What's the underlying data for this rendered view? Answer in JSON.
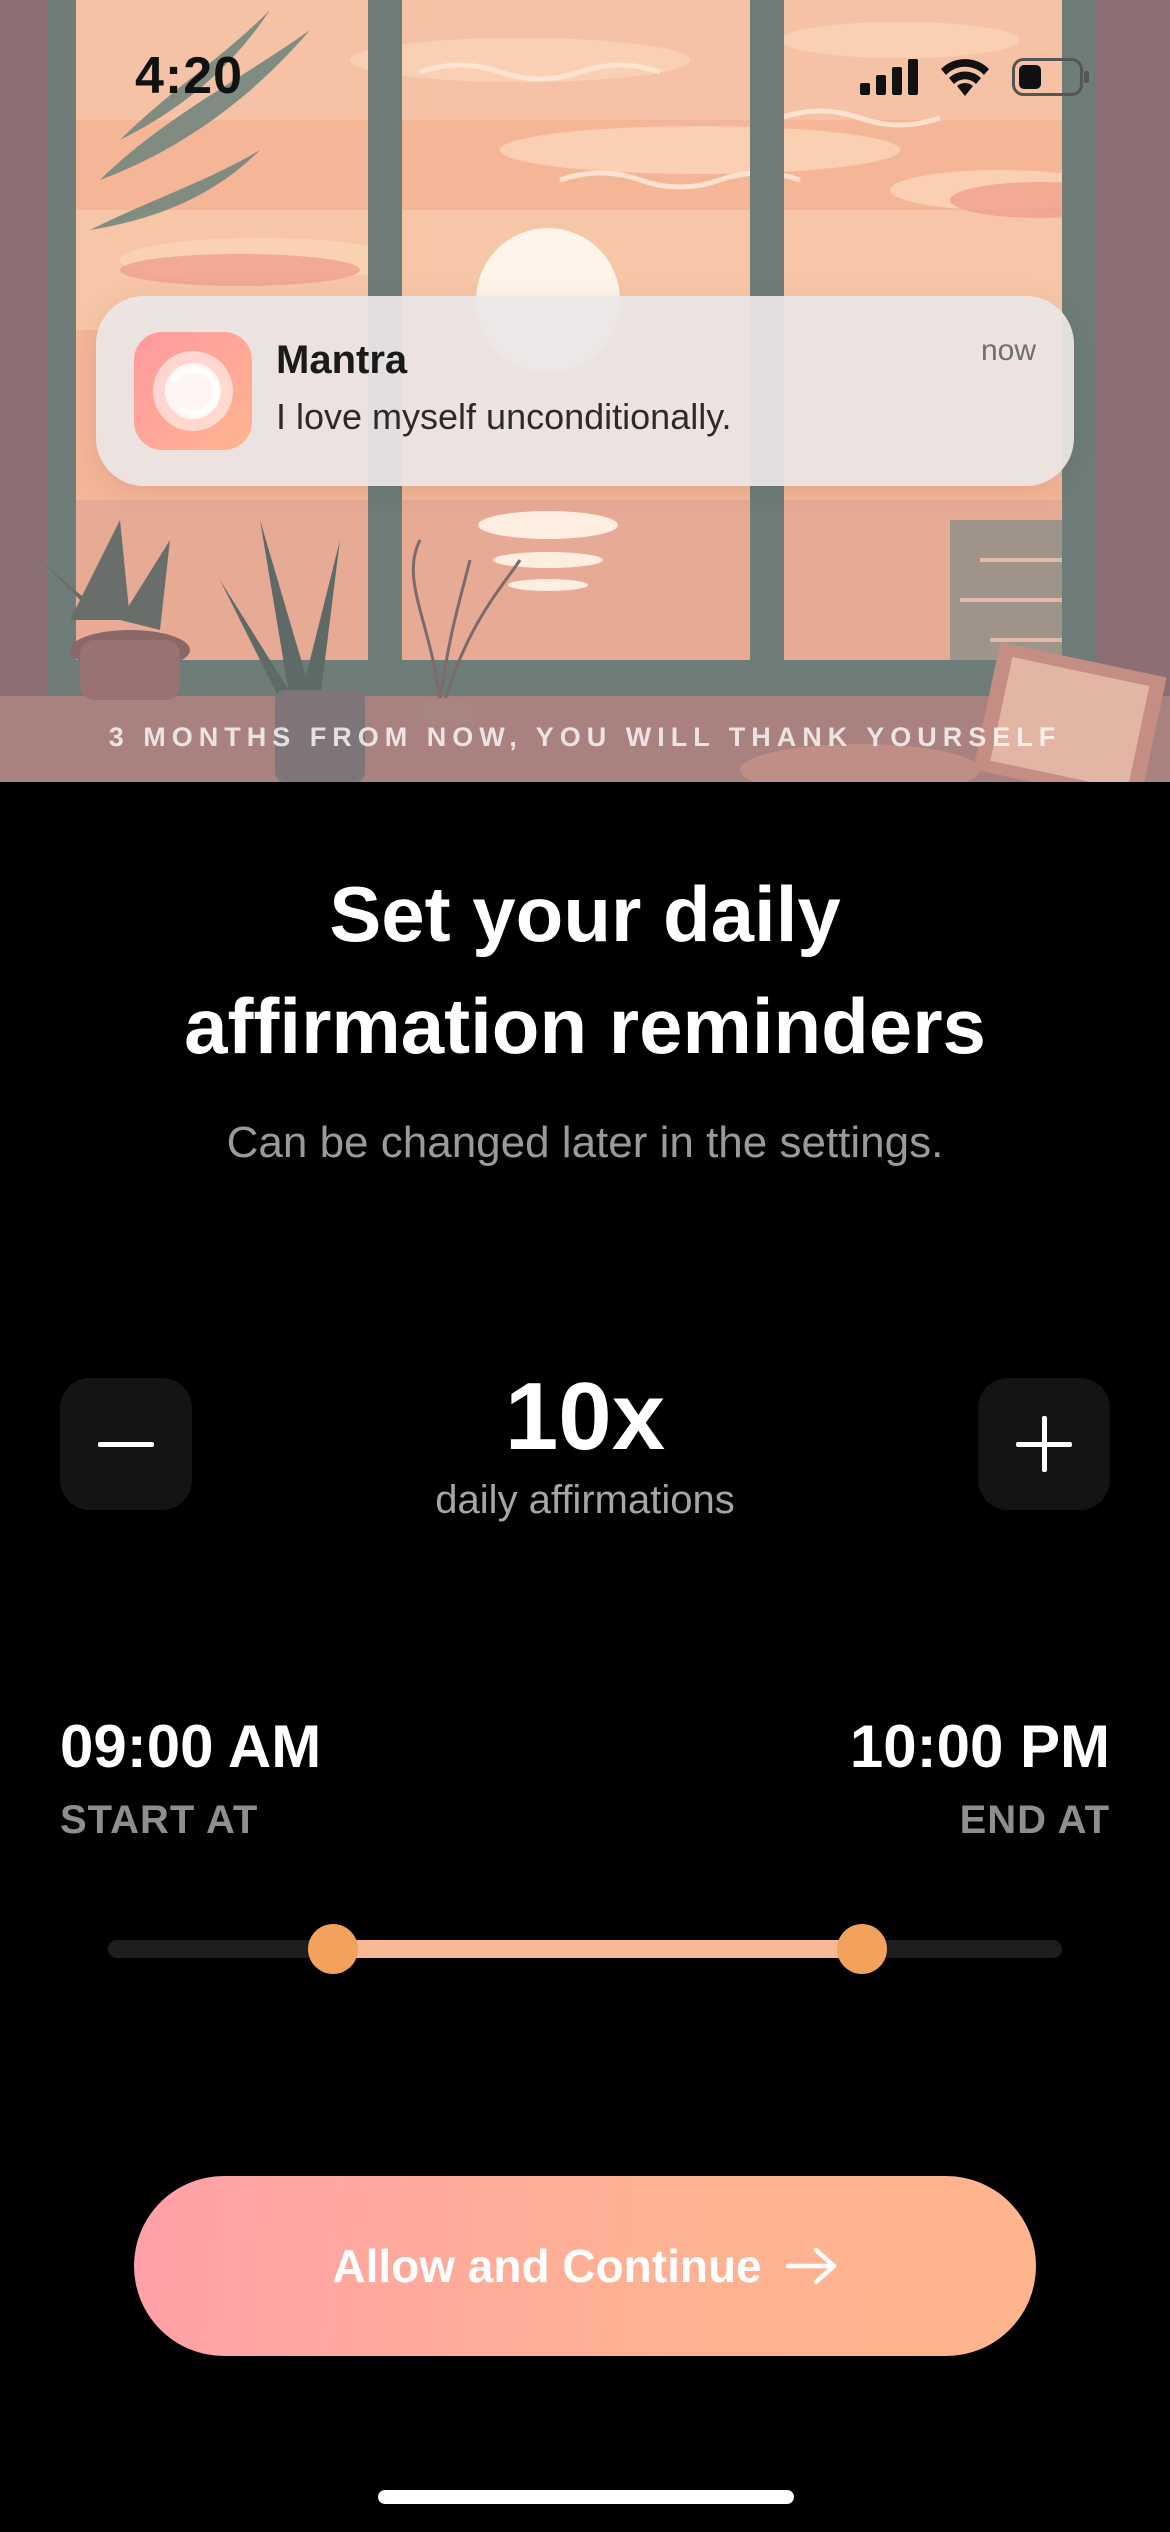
{
  "status_bar": {
    "time": "4:20",
    "icons": [
      "cellular-signal-icon",
      "wifi-icon",
      "battery-icon"
    ]
  },
  "notification": {
    "app_name": "Mantra",
    "message": "I love myself unconditionally.",
    "time": "now",
    "icon": "mantra-app-icon"
  },
  "hero": {
    "tagline": "3 MONTHS FROM NOW, YOU WILL THANK YOURSELF"
  },
  "content": {
    "title_line1": "Set your daily",
    "title_line2": "affirmation reminders",
    "subtitle": "Can be changed later in the settings."
  },
  "stepper": {
    "value": "10x",
    "label": "daily affirmations",
    "minus_icon": "minus-icon",
    "plus_icon": "plus-icon"
  },
  "time_range": {
    "start_time": "09:00 AM",
    "start_label": "START AT",
    "end_time": "10:00 PM",
    "end_label": "END AT",
    "start_fraction": 0.236,
    "end_fraction": 0.79
  },
  "cta": {
    "label": "Allow and Continue",
    "icon": "arrow-right-icon"
  },
  "colors": {
    "accent": "#f2a25c",
    "range_fill": "#f7b993",
    "cta_start": "#ffa0a8",
    "cta_end": "#ffb58c",
    "background": "#000000"
  }
}
